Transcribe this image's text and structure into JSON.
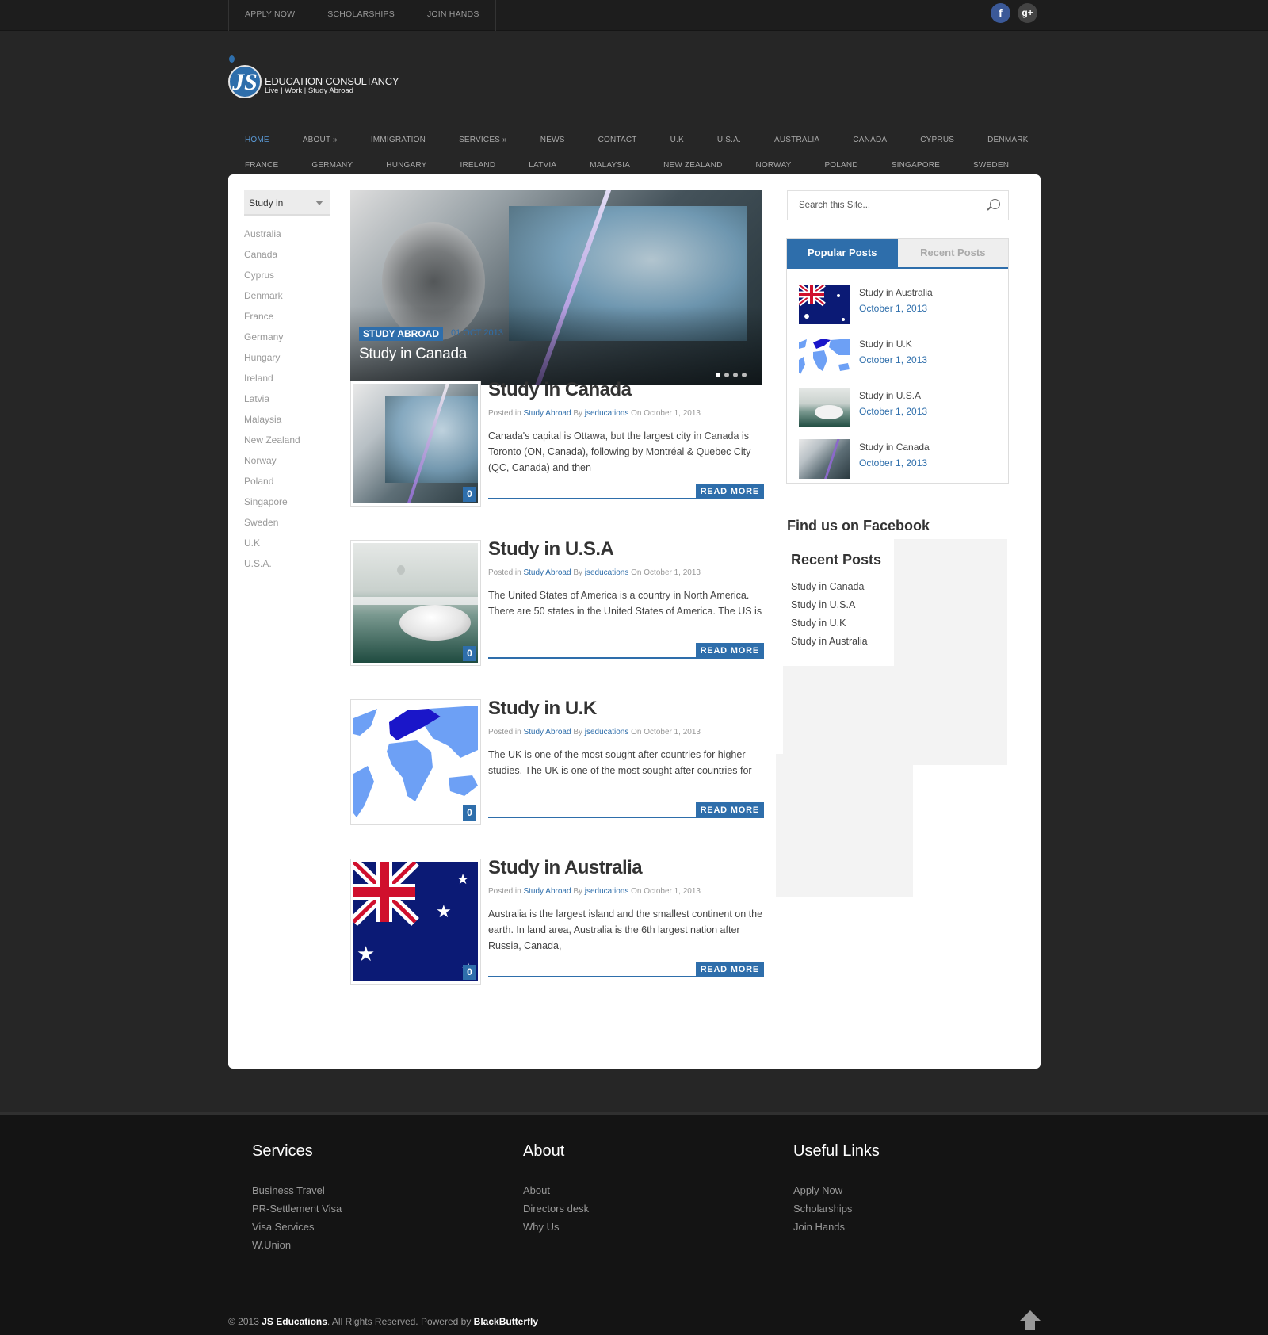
{
  "topbar": {
    "links": [
      "APPLY NOW",
      "SCHOLARSHIPS",
      "JOIN HANDS"
    ],
    "social": [
      {
        "icon": "facebook-icon",
        "glyph": "f",
        "color": "#3b5998"
      },
      {
        "icon": "google-plus-icon",
        "glyph": "g+",
        "color": "#444444"
      }
    ]
  },
  "logo": {
    "mark": "JS",
    "line1": "EDUCATION CONSULTANCY",
    "line2": "Live | Work | Study Abroad"
  },
  "nav": {
    "row1": [
      "HOME",
      "ABOUT »",
      "IMMIGRATION",
      "SERVICES »",
      "NEWS",
      "CONTACT",
      "U.K",
      "U.S.A.",
      "AUSTRALIA",
      "CANADA",
      "CYPRUS",
      "DENMARK"
    ],
    "row2": [
      "FRANCE",
      "GERMANY",
      "HUNGARY",
      "IRELAND",
      "LATVIA",
      "MALAYSIA",
      "NEW ZEALAND",
      "NORWAY",
      "POLAND",
      "SINGAPORE",
      "SWEDEN"
    ],
    "active": "HOME"
  },
  "left": {
    "select": "Study in",
    "countries": [
      "Australia",
      "Canada",
      "Cyprus",
      "Denmark",
      "France",
      "Germany",
      "Hungary",
      "Ireland",
      "Latvia",
      "Malaysia",
      "New Zealand",
      "Norway",
      "Poland",
      "Singapore",
      "Sweden",
      "U.K",
      "U.S.A."
    ]
  },
  "slider": {
    "category": "STUDY ABROAD",
    "date": "01 OCT 2013",
    "title": "Study in Canada"
  },
  "posts": [
    {
      "title": "Study in Canada",
      "posted_in": "Posted in",
      "category": "Study Abroad",
      "by": "By",
      "author": "jseducations",
      "on": "On October 1, 2013",
      "excerpt": "Canada's capital is Ottawa, but the largest city in Canada is Toronto (ON, Canada), following by Montréal & Quebec City (QC, Canada) and then",
      "comments": "0",
      "read_more": "READ MORE"
    },
    {
      "title": "Study in U.S.A",
      "posted_in": "Posted in",
      "category": "Study Abroad",
      "by": "By",
      "author": "jseducations",
      "on": "On October 1, 2013",
      "excerpt": "The United States of America is a country in North America. There are 50 states in the United States of America. The US is",
      "comments": "0",
      "read_more": "READ MORE"
    },
    {
      "title": "Study in U.K",
      "posted_in": "Posted in",
      "category": "Study Abroad",
      "by": "By",
      "author": "jseducations",
      "on": "On October 1, 2013",
      "excerpt": "The UK is one of the most sought after countries for higher studies. The UK is one of the most sought after countries for",
      "comments": "0",
      "read_more": "READ MORE"
    },
    {
      "title": "Study in Australia",
      "posted_in": "Posted in",
      "category": "Study Abroad",
      "by": "By",
      "author": "jseducations",
      "on": "On October 1, 2013",
      "excerpt": "Australia is the largest island and the smallest continent on the earth. In land area, Australia is the 6th largest nation after Russia, Canada,",
      "comments": "0",
      "read_more": "READ MORE"
    }
  ],
  "sidebar": {
    "search_placeholder": "Search this Site...",
    "tab_popular": "Popular Posts",
    "tab_recent": "Recent Posts",
    "popular": [
      {
        "title": "Study in Australia",
        "date": "October 1, 2013"
      },
      {
        "title": "Study in U.K",
        "date": "October 1, 2013"
      },
      {
        "title": "Study in U.S.A",
        "date": "October 1, 2013"
      },
      {
        "title": "Study in Canada",
        "date": "October 1, 2013"
      }
    ],
    "facebook_heading": "Find us on Facebook",
    "recent_heading": "Recent Posts",
    "recent": [
      "Study in Canada",
      "Study in U.S.A",
      "Study in U.K",
      "Study in Australia"
    ]
  },
  "footer": {
    "services": {
      "heading": "Services",
      "items": [
        "Business Travel",
        "PR-Settlement Visa",
        "Visa Services",
        "W.Union"
      ]
    },
    "about": {
      "heading": "About",
      "items": [
        "About",
        "Directors desk",
        "Why Us"
      ]
    },
    "links": {
      "heading": "Useful Links",
      "items": [
        "Apply Now",
        "Scholarships",
        "Join Hands"
      ]
    },
    "copyright_pre": "© 2013",
    "company": "JS Educations",
    "copyright_mid": ". All Rights Reserved. Powered by",
    "powered": "BlackButterfly"
  },
  "colors": {
    "accent": "#2e6eab",
    "background": "#262626",
    "footer": "#141414"
  }
}
